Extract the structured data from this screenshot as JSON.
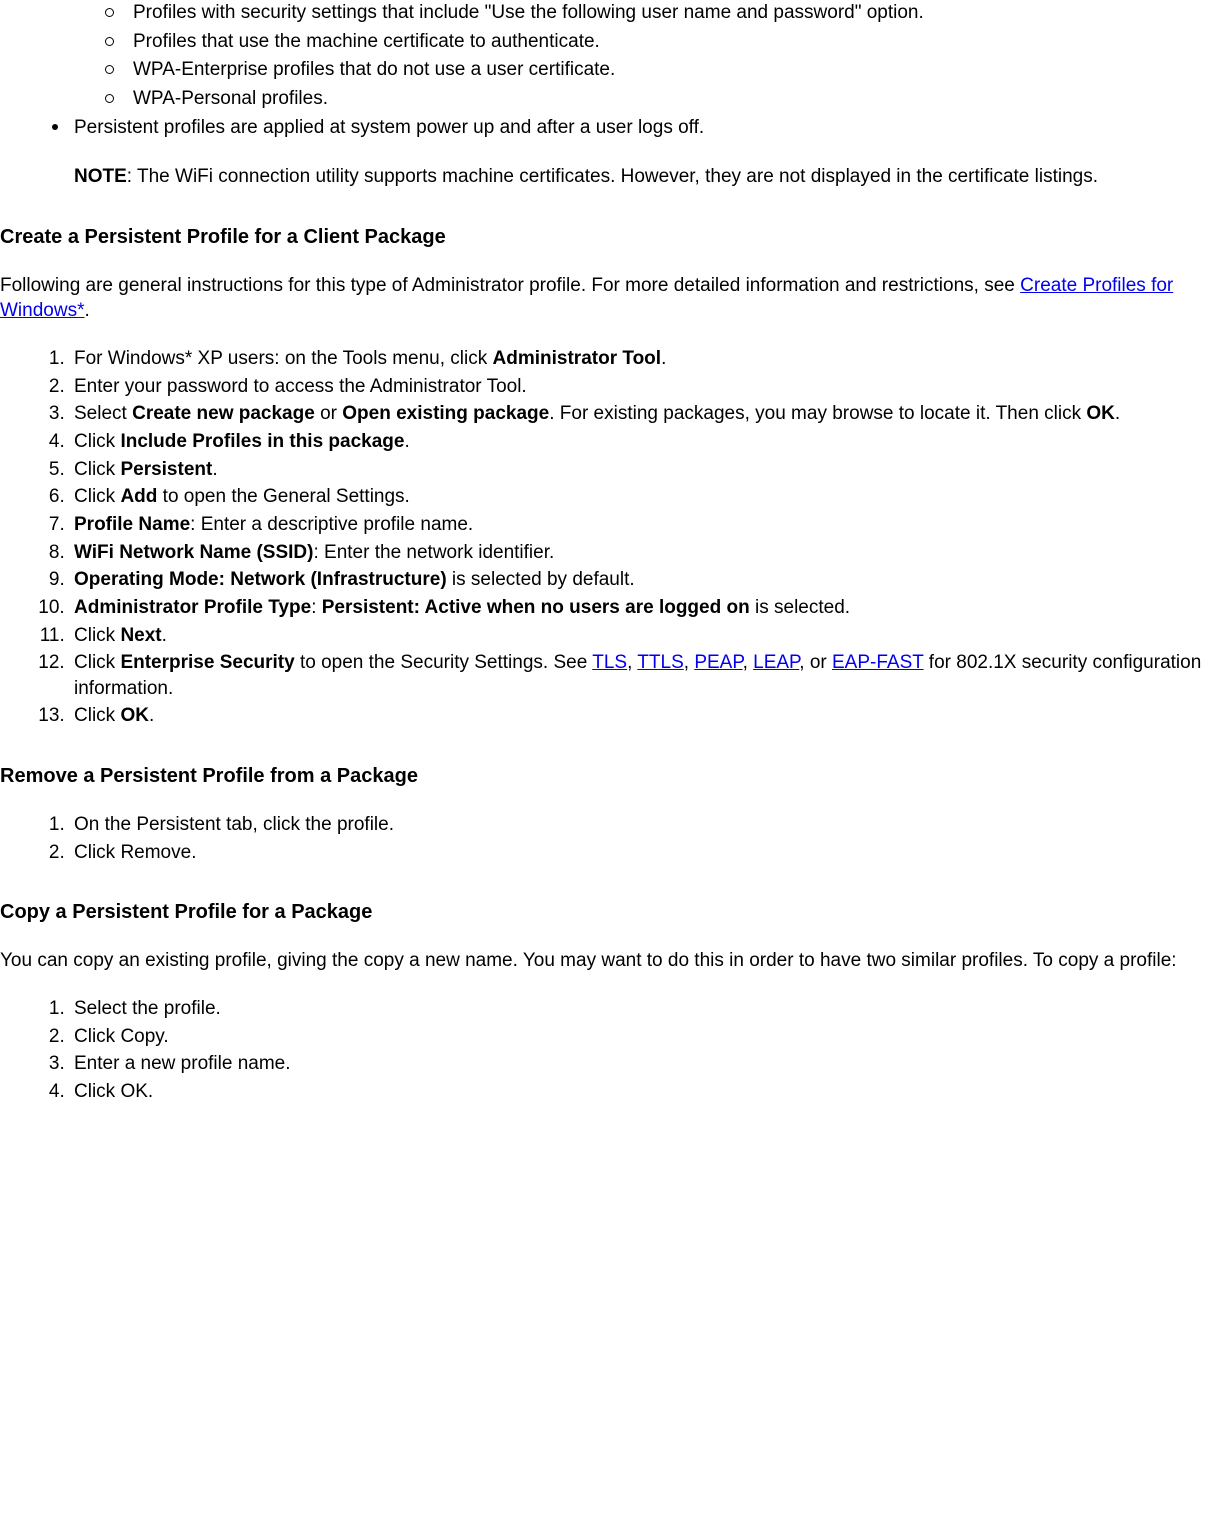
{
  "top_sublist": {
    "items": [
      "Profiles with security settings that include \"Use the following user name and password\" option.",
      "Profiles that use the machine certificate to authenticate.",
      "WPA-Enterprise profiles that do not use a user certificate.",
      "WPA-Personal profiles."
    ]
  },
  "disc_item": {
    "text": "Persistent profiles are applied at system power up and after a user logs off.",
    "note_label": "NOTE",
    "note_text": ": The WiFi connection utility supports machine certificates. However, they are not displayed in the certificate listings."
  },
  "section_create": {
    "heading": "Create a Persistent Profile for a Client Package",
    "intro_pre": "Following are general instructions for this type of Administrator profile. For more detailed information and restrictions, see ",
    "intro_link": "Create Profiles for Windows*",
    "intro_post": ".",
    "steps": {
      "s1_pre": "For Windows* XP users: on the Tools menu, click ",
      "s1_b": "Administrator Tool",
      "s1_post": ".",
      "s2": "Enter your password to access the Administrator Tool.",
      "s3_pre": "Select ",
      "s3_b1": "Create new package",
      "s3_mid": " or ",
      "s3_b2": "Open existing package",
      "s3_post1": ". For existing packages, you may browse to locate it. Then click ",
      "s3_b3": "OK",
      "s3_post2": ".",
      "s4_pre": "Click ",
      "s4_b": "Include Profiles in this package",
      "s4_post": ".",
      "s5_pre": "Click ",
      "s5_b": "Persistent",
      "s5_post": ".",
      "s6_pre": "Click ",
      "s6_b": "Add",
      "s6_post": " to open the General Settings.",
      "s7_b": "Profile Name",
      "s7_post": ": Enter a descriptive profile name.",
      "s8_b": "WiFi Network Name (SSID)",
      "s8_post": ": Enter the network identifier.",
      "s9_b": "Operating Mode: Network (Infrastructure)",
      "s9_post": " is selected by default.",
      "s10_b1": "Administrator Profile Type",
      "s10_mid": ": ",
      "s10_b2": "Persistent: Active when no users are logged on",
      "s10_post": " is selected.",
      "s11_pre": "Click ",
      "s11_b": "Next",
      "s11_post": ".",
      "s12_pre": "Click ",
      "s12_b": "Enterprise Security",
      "s12_mid": " to open the Security Settings. See ",
      "s12_l1": "TLS",
      "s12_c1": ", ",
      "s12_l2": "TTLS",
      "s12_c2": ", ",
      "s12_l3": "PEAP",
      "s12_c3": ", ",
      "s12_l4": "LEAP",
      "s12_c4": ", or ",
      "s12_l5": "EAP-FAST",
      "s12_post": " for 802.1X security configuration information.",
      "s13_pre": "Click ",
      "s13_b": "OK",
      "s13_post": "."
    }
  },
  "section_remove": {
    "heading": "Remove a Persistent Profile from a Package",
    "steps": [
      "On the Persistent tab, click the profile.",
      "Click Remove."
    ]
  },
  "section_copy": {
    "heading": "Copy a Persistent Profile for a Package",
    "intro": "You can copy an existing profile, giving the copy a new name. You may want to do this in order to have two similar profiles. To copy a profile:",
    "steps": [
      "Select the profile.",
      "Click Copy.",
      "Enter a new profile name.",
      "Click OK."
    ]
  }
}
